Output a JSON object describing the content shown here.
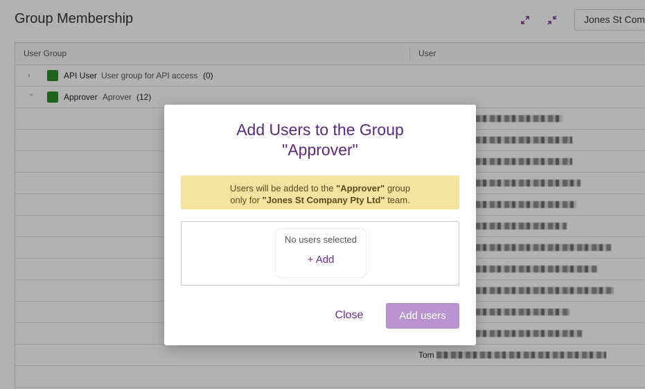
{
  "page": {
    "title": "Group Membership",
    "team_selector": "Jones St Company Pty Ltd",
    "icons": [
      "expand-icon",
      "collapse-icon"
    ]
  },
  "grid": {
    "columns": [
      "User Group",
      "User"
    ],
    "groups": [
      {
        "name": "API User",
        "description": "User group for API access",
        "count": "(0)",
        "expanded": false,
        "color": "#2e8b2e"
      },
      {
        "name": "Approver",
        "description": "Aprover",
        "count": "(12)",
        "expanded": true,
        "color": "#2e8b2e"
      }
    ],
    "visible_user_prefix": "Tom"
  },
  "modal": {
    "title_line1": "Add Users to the Group",
    "title_line2": "\"Approver\"",
    "notice": {
      "part1": "Users will be added to the ",
      "group": "\"Approver\"",
      "part2": " group",
      "part3": "only for ",
      "team": "\"Jones St Company Pty Ltd\"",
      "part4": " team."
    },
    "picker": {
      "empty_text": "No users selected",
      "add_label": "+ Add"
    },
    "close_label": "Close",
    "add_users_label": "Add users"
  },
  "colors": {
    "accent": "#6b2f8a",
    "notice_bg": "#f4e4a2",
    "group_swatch": "#2e8b2e",
    "disabled_button": "#b893cf"
  }
}
